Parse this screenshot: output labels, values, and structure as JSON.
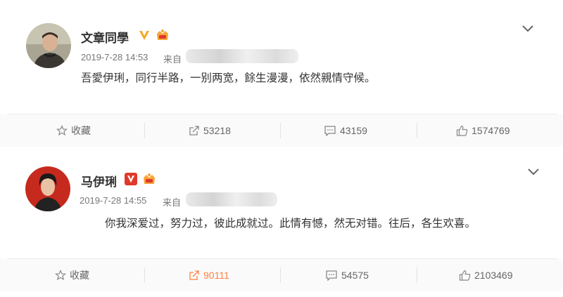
{
  "posts": [
    {
      "author": "文章同學",
      "timestamp": "2019-7-28 14:53",
      "source_prefix": "来自",
      "content": "吾愛伊琍，同行半路，一别两宽，餘生漫漫，依然親情守候。",
      "verified_badge": "gold-v",
      "actions": {
        "favorite": "收藏",
        "repost": "53218",
        "comment": "43159",
        "like": "1574769"
      }
    },
    {
      "author": "马伊琍",
      "timestamp": "2019-7-28 14:55",
      "source_prefix": "来自",
      "content": "你我深爱过，努力过，彼此成就过。此情有憾，然无对错。往后，各生欢喜。",
      "verified_badge": "red-v",
      "actions": {
        "favorite": "收藏",
        "repost": "90111",
        "comment": "54575",
        "like": "2103469"
      }
    }
  ],
  "colors": {
    "accent_orange": "#ff8140",
    "verified_gold": "#f5a623",
    "verified_red": "#e0392b"
  },
  "icons": [
    "chevron-down-icon",
    "verified-v-icon",
    "crown-badge-icon",
    "star-icon",
    "repost-icon",
    "comment-icon",
    "like-icon"
  ]
}
